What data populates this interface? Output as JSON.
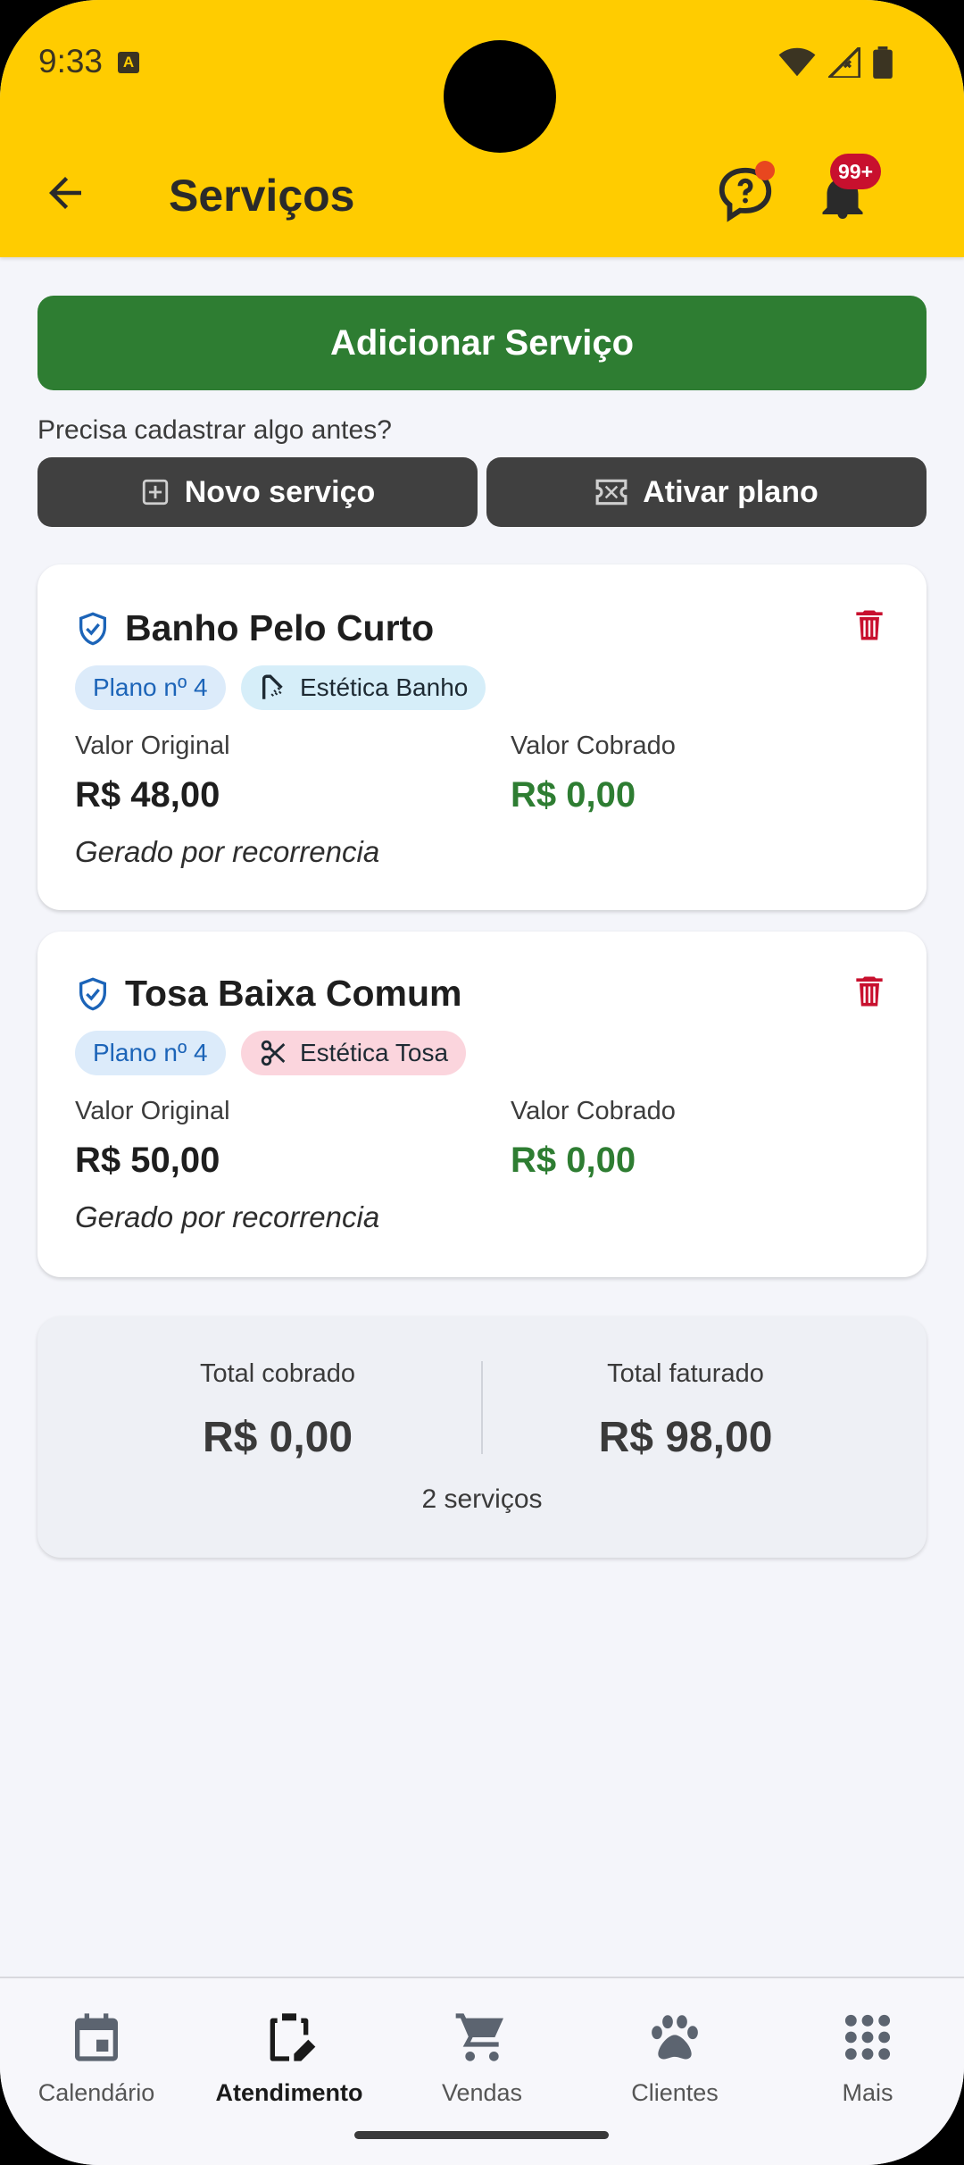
{
  "status_bar": {
    "time": "9:33",
    "app_indicator": "A"
  },
  "header": {
    "title": "Serviços",
    "notification_badge": "99+",
    "colors": {
      "background": "#ffcc00"
    }
  },
  "actions": {
    "add_service": "Adicionar Serviço",
    "hint": "Precisa cadastrar algo antes?",
    "new_service": "Novo serviço",
    "activate_plan": "Ativar plano"
  },
  "services": [
    {
      "name": "Banho Pelo Curto",
      "plan_chip": "Plano nº 4",
      "category_chip": "Estética Banho",
      "category_icon": "shower-icon",
      "original_label": "Valor Original",
      "original_value": "R$ 48,00",
      "charged_label": "Valor Cobrado",
      "charged_value": "R$ 0,00",
      "note": "Gerado por recorrencia"
    },
    {
      "name": "Tosa Baixa Comum",
      "plan_chip": "Plano nº 4",
      "category_chip": "Estética Tosa",
      "category_icon": "scissors-icon",
      "original_label": "Valor Original",
      "original_value": "R$ 50,00",
      "charged_label": "Valor Cobrado",
      "charged_value": "R$ 0,00",
      "note": "Gerado por recorrencia"
    }
  ],
  "totals": {
    "charged_label": "Total cobrado",
    "charged_value": "R$ 0,00",
    "billed_label": "Total faturado",
    "billed_value": "R$ 98,00",
    "count": "2 serviços"
  },
  "bottom_nav": {
    "items": [
      {
        "label": "Calendário",
        "icon": "calendar-icon"
      },
      {
        "label": "Atendimento",
        "icon": "clipboard-edit-icon",
        "active": true
      },
      {
        "label": "Vendas",
        "icon": "cart-icon"
      },
      {
        "label": "Clientes",
        "icon": "paw-icon"
      },
      {
        "label": "Mais",
        "icon": "grid-dots-icon"
      }
    ]
  }
}
